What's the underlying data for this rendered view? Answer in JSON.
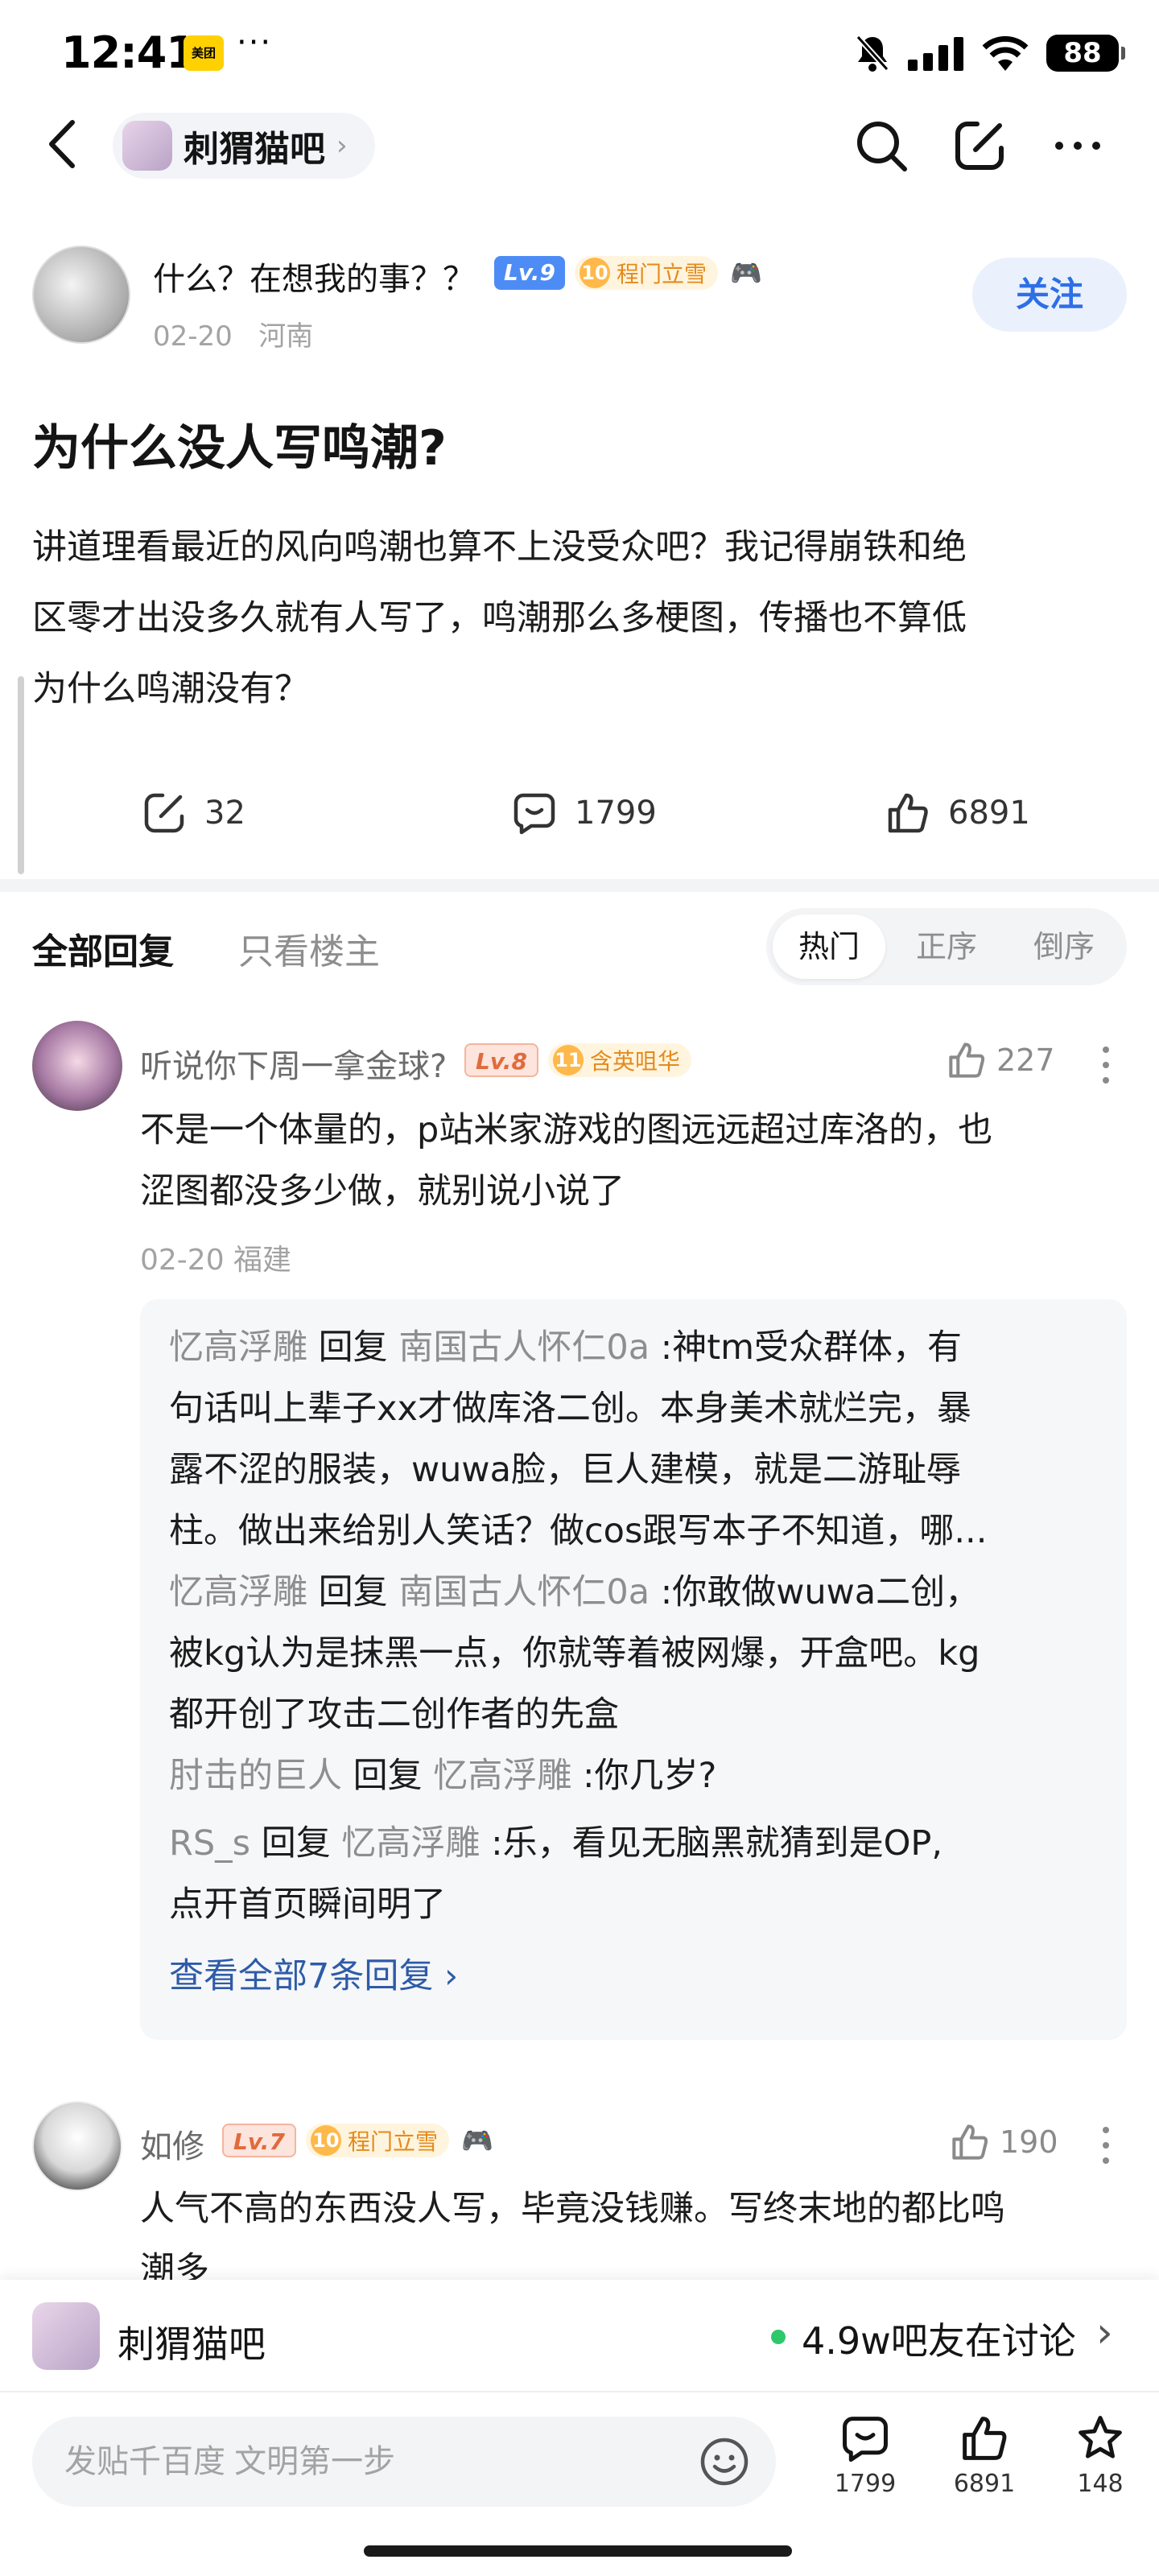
{
  "status_bar": {
    "time": "12:41",
    "app_badge": "美团",
    "dots": "···",
    "battery": "88"
  },
  "nav": {
    "forum_name": "刺猬猫吧",
    "chevron": "›"
  },
  "post": {
    "author": "什么？在想我的事？？",
    "level": "Lv.9",
    "honor_level": "10",
    "honor_title": "程门立雪",
    "date": "02-20",
    "location": "河南",
    "follow_label": "关注",
    "title": "为什么没人写鸣潮?",
    "body_lines": [
      "讲道理看最近的风向鸣潮也算不上没受众吧？我记得崩铁和绝",
      "区零才出没多久就有人写了，鸣潮那么多梗图，传播也不算低",
      "为什么鸣潮没有？"
    ],
    "share_count": "32",
    "comment_count": "1799",
    "like_count": "6891"
  },
  "reply_tabs": {
    "all": "全部回复",
    "op_only": "只看楼主",
    "sort_hot": "热门",
    "sort_asc": "正序",
    "sort_desc": "倒序"
  },
  "comments": [
    {
      "name": "听说你下周一拿金球?",
      "level": "Lv.8",
      "honor_level": "11",
      "honor_title": "含英咀华",
      "likes": "227",
      "text_lines": [
        "不是一个体量的，p站米家游戏的图远远超过库洛的，也",
        "涩图都没多少做，就别说小说了"
      ],
      "meta": "02-20 福建",
      "replies": [
        {
          "from": "忆高浮雕",
          "verb": "回复",
          "to": "南国古人怀仁0a",
          "lines": [
            ":神tm受众群体，有",
            "句话叫上辈子xx才做库洛二创。本身美术就烂完，暴",
            "露不涩的服装，wuwa脸，巨人建模，就是二游耻辱",
            "柱。做出来给别人笑话？做cos跟写本子不知道，哪..."
          ]
        },
        {
          "from": "忆高浮雕",
          "verb": "回复",
          "to": "南国古人怀仁0a",
          "lines": [
            ":你敢做wuwa二创，",
            "被kg认为是抹黑一点，你就等着被网爆，开盒吧。kg",
            "都开创了攻击二创作者的先盒"
          ]
        },
        {
          "from": "肘击的巨人",
          "verb": "回复",
          "to": "忆高浮雕",
          "lines": [
            ":你几岁?"
          ]
        },
        {
          "from": "RS_s",
          "verb": "回复",
          "to": "忆高浮雕",
          "lines": [
            ":乐，看见无脑黑就猜到是OP,",
            "点开首页瞬间明了"
          ]
        }
      ],
      "view_all": "查看全部7条回复 ›"
    },
    {
      "name": "如修",
      "level": "Lv.7",
      "honor_level": "10",
      "honor_title": "程门立雪",
      "likes": "190",
      "text_lines": [
        "人气不高的东西没人写，毕竟没钱赚。写终末地的都比鸣",
        "潮多"
      ]
    }
  ],
  "forum_bar": {
    "name": "刺猬猫吧",
    "discussing": "4.9w吧友在讨论",
    "chevron": "›"
  },
  "input_bar": {
    "placeholder": "发贴千百度 文明第一步",
    "comments": "1799",
    "likes": "6891",
    "favorites": "148"
  },
  "colors": {
    "accent_blue": "#2e6fe6",
    "link_blue": "#2e5ba8",
    "online_green": "#2ec76a",
    "honor_orange": "#e48a1c"
  },
  "icons": [
    "back-icon",
    "search-icon",
    "edit-icon",
    "more-icon",
    "share-icon",
    "comment-icon",
    "like-icon",
    "emoji-icon",
    "star-icon"
  ]
}
